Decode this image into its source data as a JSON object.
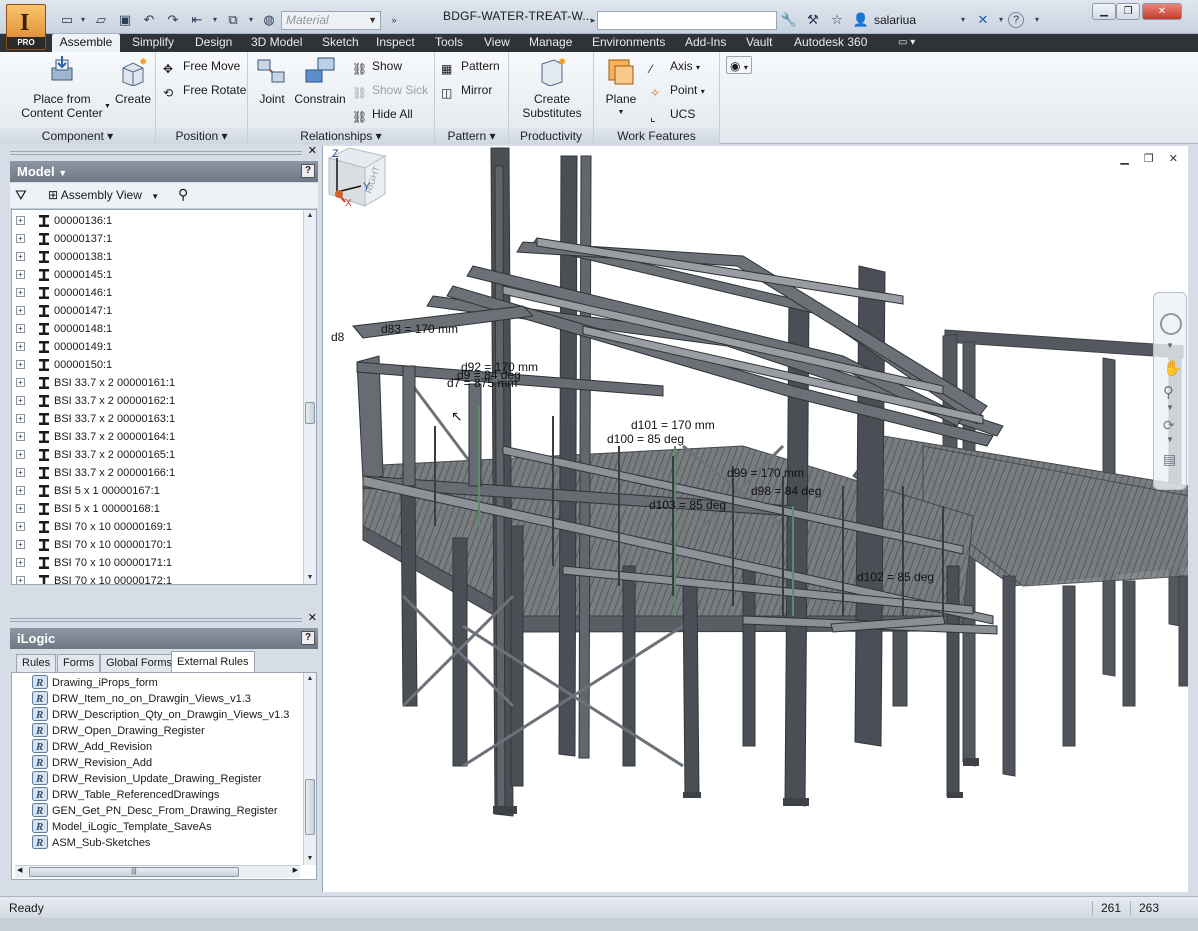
{
  "app": {
    "logo_badge": "PRO",
    "document_title": "BDGF-WATER-TREAT-W...",
    "material_placeholder": "Material",
    "user": "salariua"
  },
  "ribbon_tabs": [
    "Assemble",
    "Simplify",
    "Design",
    "3D Model",
    "Sketch",
    "Inspect",
    "Tools",
    "View",
    "Manage",
    "Environments",
    "Add-Ins",
    "Vault",
    "Autodesk 360"
  ],
  "ribbon": {
    "component": {
      "footer": "Component",
      "place_line1": "Place from",
      "place_line2": "Content Center",
      "create": "Create"
    },
    "position": {
      "footer": "Position",
      "free_move": "Free Move",
      "free_rotate": "Free Rotate"
    },
    "relationships": {
      "footer": "Relationships",
      "joint": "Joint",
      "constrain": "Constrain",
      "show": "Show",
      "show_sick": "Show Sick",
      "hide_all": "Hide All"
    },
    "pattern": {
      "footer": "Pattern",
      "pattern": "Pattern",
      "mirror": "Mirror"
    },
    "productivity": {
      "footer": "Productivity",
      "create_line1": "Create",
      "create_line2": "Substitutes"
    },
    "work_features": {
      "footer": "Work Features",
      "plane": "Plane",
      "axis": "Axis",
      "point": "Point",
      "ucs": "UCS"
    }
  },
  "model_panel": {
    "title": "Model",
    "view_label": "Assembly View",
    "help": "?",
    "tree_items": [
      "00000136:1",
      "00000137:1",
      "00000138:1",
      "00000145:1",
      "00000146:1",
      "00000147:1",
      "00000148:1",
      "00000149:1",
      "00000150:1",
      "BSI 33.7 x 2 00000161:1",
      "BSI 33.7 x 2 00000162:1",
      "BSI 33.7 x 2 00000163:1",
      "BSI 33.7 x 2 00000164:1",
      "BSI 33.7 x 2 00000165:1",
      "BSI 33.7 x 2 00000166:1",
      "BSI 5 x 1 00000167:1",
      "BSI 5 x 1 00000168:1",
      "BSI 70 x 10 00000169:1",
      "BSI 70 x 10 00000170:1",
      "BSI 70 x 10 00000171:1",
      "BSI 70 x 10 00000172:1"
    ]
  },
  "ilogic_panel": {
    "title": "iLogic",
    "help": "?",
    "tabs": [
      "Rules",
      "Forms",
      "Global Forms",
      "External Rules"
    ],
    "active_tab": "External Rules",
    "rules": [
      "Drawing_iProps_form",
      "DRW_Item_no_on_Drawgin_Views_v1.3",
      "DRW_Description_Qty_on_Drawgin_Views_v1.3",
      "DRW_Open_Drawing_Register",
      "DRW_Add_Revision",
      "DRW_Revision_Add",
      "DRW_Revision_Update_Drawing_Register",
      "DRW_Table_ReferencedDrawings",
      "GEN_Get_PN_Desc_From_Drawing_Register",
      "Model_iLogic_Template_SaveAs",
      "ASM_Sub-Sketches"
    ]
  },
  "viewport": {
    "viewcube_face": "RIGHT",
    "triad_z": "Z",
    "triad_y": "Y",
    "triad_x": "X",
    "dimensions": [
      {
        "id": "d83",
        "text": "d83 = 170 mm"
      },
      {
        "id": "d8x",
        "text": "d8"
      },
      {
        "id": "d9x",
        "text": "d92 = 170 mm"
      },
      {
        "id": "d9y",
        "text": "d9 = 84 deg"
      },
      {
        "id": "d7x",
        "text": "d7 = 875 mm"
      },
      {
        "id": "d101",
        "text": "d101 = 170 mm"
      },
      {
        "id": "d100",
        "text": "d100 = 85 deg"
      },
      {
        "id": "d99",
        "text": "d99 = 170 mm"
      },
      {
        "id": "d98",
        "text": "d98 = 84 deg"
      },
      {
        "id": "dmid",
        "text": "d103 = 85 deg"
      },
      {
        "id": "dlow",
        "text": "d102 = 85 deg"
      }
    ]
  },
  "status": {
    "text": "Ready",
    "num1": "261",
    "num2": "263"
  },
  "colors": {
    "tabbar": "#2f3337",
    "steel": "#4a4e55",
    "grating": "#7c7f82",
    "panel_head": "#7c8693"
  }
}
